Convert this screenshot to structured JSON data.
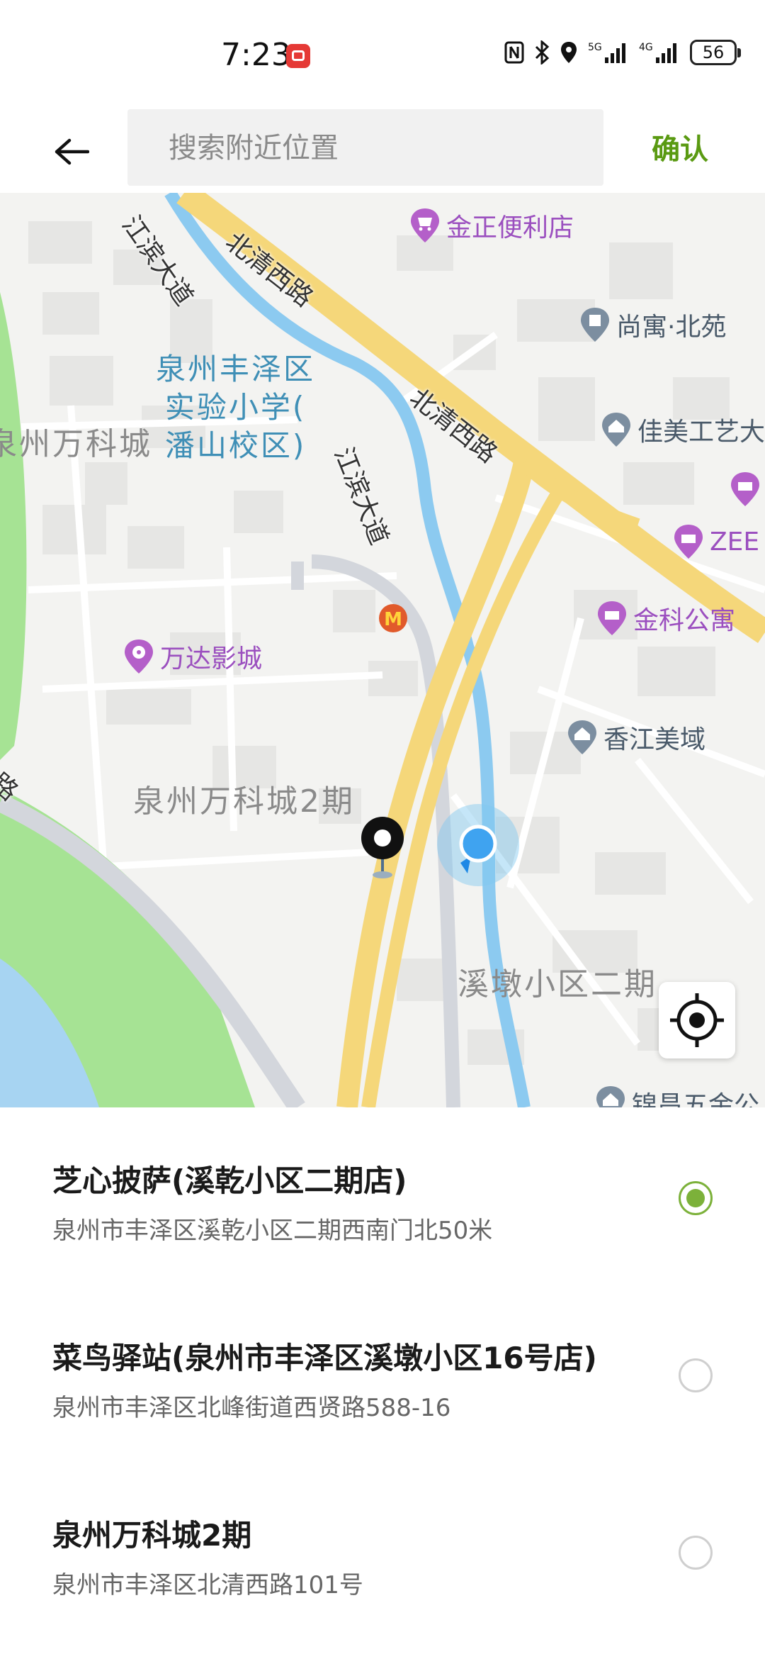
{
  "status_bar": {
    "time": "7:23",
    "battery": "56",
    "icons": [
      "nfc-icon",
      "bluetooth-icon",
      "location-icon",
      "5g-signal-icon",
      "4g-signal-icon",
      "battery-icon"
    ]
  },
  "header": {
    "search_placeholder": "搜索附近位置",
    "confirm_label": "确认",
    "accent_color": "#5a9a12"
  },
  "map": {
    "road_labels": [
      "北清西路",
      "北清西路",
      "江滨大道",
      "江滨大道",
      "路"
    ],
    "area_labels": [
      "泉州万科城",
      "泉州万科城2期",
      "溪墩小区二期"
    ],
    "school_label": [
      "泉州丰泽区",
      "实验小学(",
      "潘山校区)"
    ],
    "pois": [
      {
        "name": "金正便利店",
        "type": "shop"
      },
      {
        "name": "尚寓·北苑",
        "type": "residence"
      },
      {
        "name": "佳美工艺大",
        "type": "residence"
      },
      {
        "name": "ZEE",
        "type": "hotel"
      },
      {
        "name": "金科公寓",
        "type": "hotel"
      },
      {
        "name": "万达影城",
        "type": "cinema"
      },
      {
        "name": "香江美域",
        "type": "residence"
      },
      {
        "name": "锦昌五金公",
        "type": "residence"
      }
    ]
  },
  "locations": [
    {
      "title": "芝心披萨(溪乾小区二期店)",
      "address": "泉州市丰泽区溪乾小区二期西南门北50米",
      "selected": true
    },
    {
      "title": "菜鸟驿站(泉州市丰泽区溪墩小区16号店)",
      "address": "泉州市丰泽区北峰街道西贤路588-16",
      "selected": false
    },
    {
      "title": "泉州万科城2期",
      "address": "泉州市丰泽区北清西路101号",
      "selected": false
    }
  ],
  "colors": {
    "selected_radio": "#7cb13a",
    "poi_purple": "#9b4fbf",
    "road_yellow": "#f5d77a",
    "river_blue": "#8ccaf0",
    "park_green": "#a6e394"
  }
}
